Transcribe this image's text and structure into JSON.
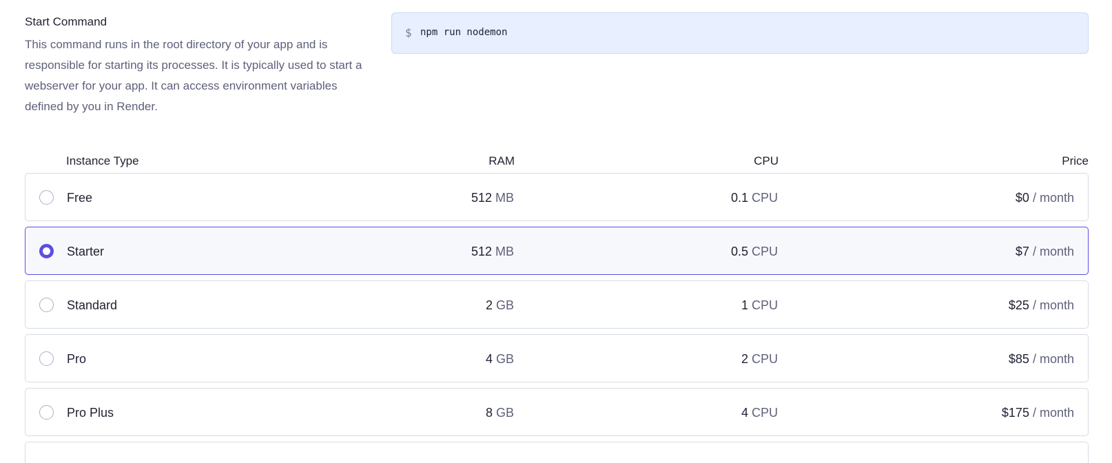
{
  "start_command": {
    "title": "Start Command",
    "description": "This command runs in the root directory of your app and is responsible for starting its processes. It is typically used to start a webserver for your app. It can access environment variables defined by you in Render.",
    "prompt_symbol": "$",
    "value": "npm run nodemon"
  },
  "table": {
    "headers": {
      "type": "Instance Type",
      "ram": "RAM",
      "cpu": "CPU",
      "price": "Price"
    },
    "rows": [
      {
        "name": "Free",
        "ram": "512",
        "ram_unit": "MB",
        "cpu": "0.1",
        "cpu_unit": "CPU",
        "price": "$0",
        "price_unit": "/ month",
        "selected": false
      },
      {
        "name": "Starter",
        "ram": "512",
        "ram_unit": "MB",
        "cpu": "0.5",
        "cpu_unit": "CPU",
        "price": "$7",
        "price_unit": "/ month",
        "selected": true
      },
      {
        "name": "Standard",
        "ram": "2",
        "ram_unit": "GB",
        "cpu": "1",
        "cpu_unit": "CPU",
        "price": "$25",
        "price_unit": "/ month",
        "selected": false
      },
      {
        "name": "Pro",
        "ram": "4",
        "ram_unit": "GB",
        "cpu": "2",
        "cpu_unit": "CPU",
        "price": "$85",
        "price_unit": "/ month",
        "selected": false
      },
      {
        "name": "Pro Plus",
        "ram": "8",
        "ram_unit": "GB",
        "cpu": "4",
        "cpu_unit": "CPU",
        "price": "$175",
        "price_unit": "/ month",
        "selected": false
      }
    ]
  },
  "colors": {
    "accent": "#5b4ee3",
    "command_bg": "#e8efff",
    "muted_text": "#5e607a"
  }
}
